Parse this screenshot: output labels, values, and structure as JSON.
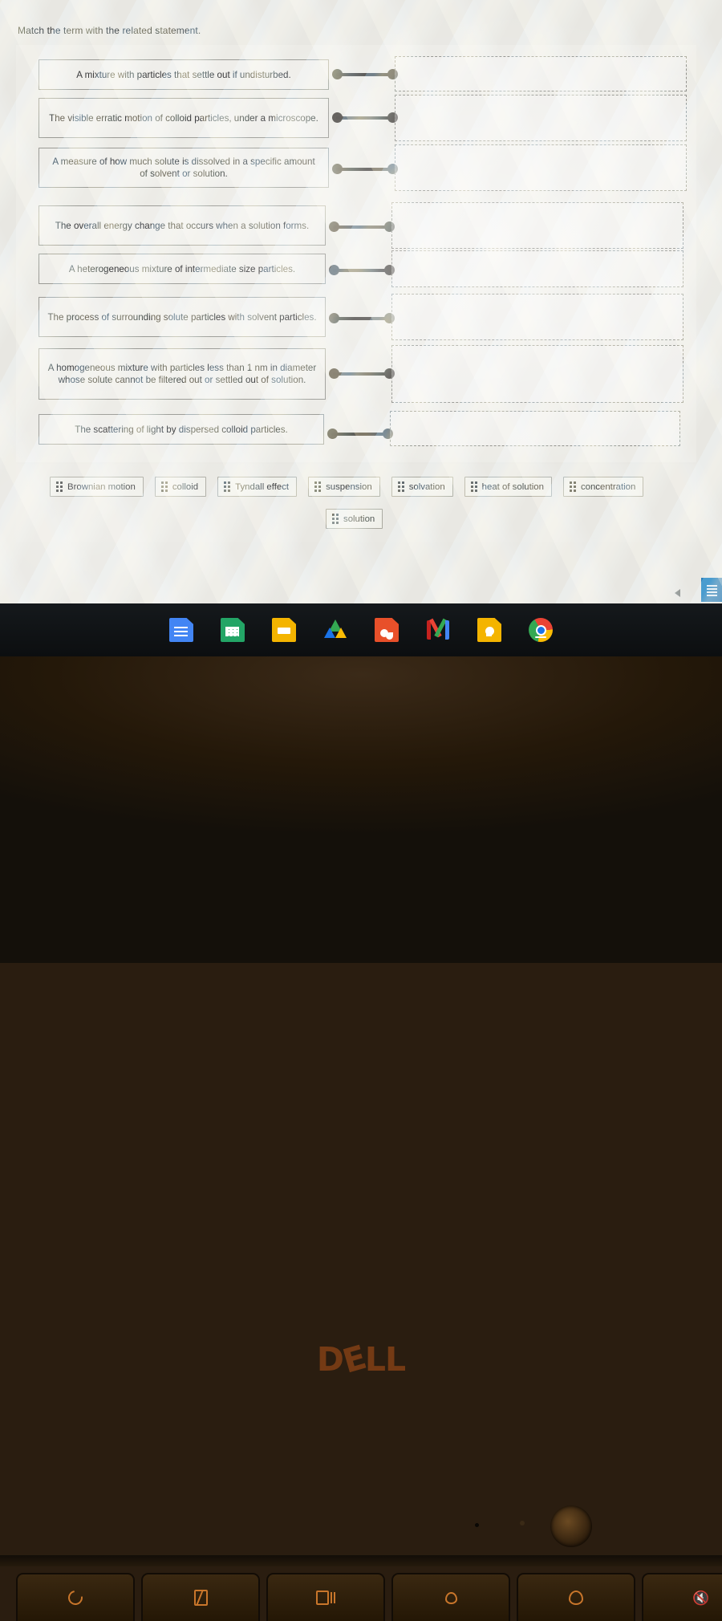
{
  "quiz": {
    "prompt": "Match the term with the related statement.",
    "statements": [
      "A mixture with particles that settle out if undisturbed.",
      "The visible erratic motion of colloid particles, under a microscope.",
      "A measure of how much solute is dissolved in a specific amount of solvent or solution.",
      "The overall energy change that occurs when a solution forms.",
      "A heterogeneous mixture of intermediate size particles.",
      "The process of surrounding solute particles with solvent particles.",
      "A homogeneous mixture with particles less than 1 nm in diameter whose solute cannot be filtered out or settled out of solution.",
      "The scattering of light by dispersed colloid particles."
    ],
    "drop_zones": [
      "",
      "",
      "",
      "",
      "",
      "",
      "",
      ""
    ],
    "answer_bank": [
      "Brownian motion",
      "colloid",
      "Tyndall effect",
      "suspension",
      "solvation",
      "heat of solution",
      "concentration",
      "solution"
    ]
  },
  "shelf": {
    "items": [
      "google-docs",
      "google-sheets",
      "google-slides",
      "google-drive",
      "google-photos",
      "gmail",
      "google-keep",
      "google-chrome"
    ]
  },
  "laptop": {
    "brand": "D",
    "brand_e": "E",
    "brand_tail": "LL"
  },
  "keys": [
    "reload",
    "fullscreen",
    "overview",
    "brightness-down",
    "brightness-up",
    "mute"
  ],
  "colors": {
    "accent_blue": "#2b7dba",
    "dell_orange": "#7b3d15",
    "connector": "#4f4c48",
    "border": "#9a9a95"
  }
}
